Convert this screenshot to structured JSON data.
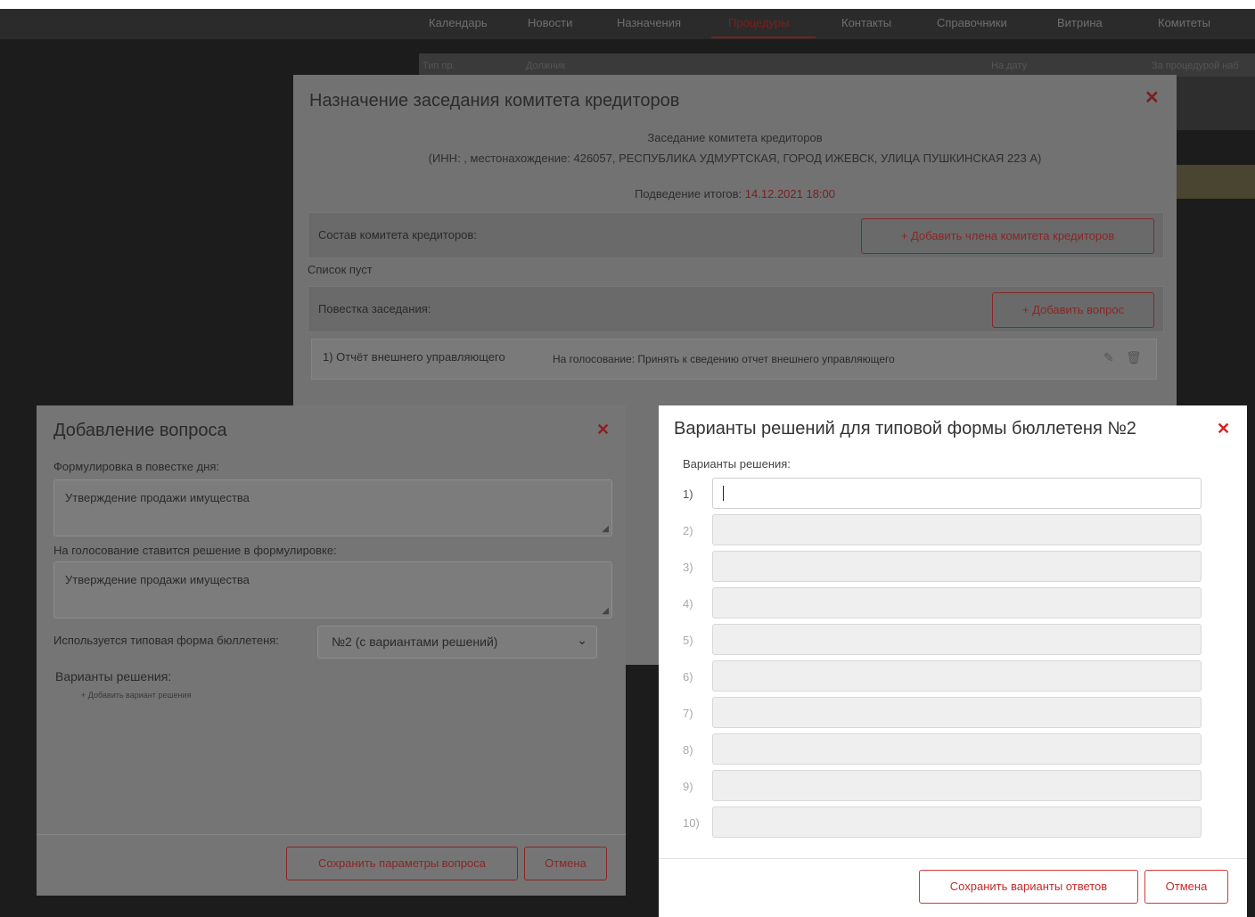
{
  "nav": {
    "items": [
      "Календарь",
      "Новости",
      "Назначения",
      "Процедуры",
      "Контакты",
      "Справочники",
      "Витрина",
      "Комитеты"
    ],
    "active": "Процедуры"
  },
  "background_table": {
    "headers": [
      "Тип пр.",
      "Должник",
      "На дату",
      "За процедурой наб"
    ]
  },
  "main_dialog": {
    "title": "Назначение заседания комитета кредиторов",
    "meeting_name": "Заседание комитета кредиторов",
    "address_line": "(ИНН: , местонахождение: 426057, РЕСПУБЛИКА УДМУРТСКАЯ, ГОРОД ИЖЕВСК, УЛИЦА ПУШКИНСКАЯ 223 А)",
    "results_label": "Подведение итогов:",
    "results_date": "14.12.2021 18:00",
    "committee_label": "Состав комитета кредиторов:",
    "add_member_button": "+ Добавить члена комитета кредиторов",
    "list_empty": "Список пуст",
    "agenda_label": "Повестка заседания:",
    "add_question_button": "+ Добавить вопрос",
    "agenda_item": {
      "question": "1) Отчёт внешнего управляющего",
      "vote": "На голосование: Принять к сведению отчет внешнего управляющего"
    }
  },
  "add_question_dialog": {
    "title": "Добавление вопроса",
    "agenda_wording_label": "Формулировка в повестке дня:",
    "agenda_wording_value": "Утверждение продажи имущества",
    "vote_wording_label": "На голосование ставится решение в формулировке:",
    "vote_wording_value": "Утверждение продажи имущества",
    "ballot_form_label": "Используется типовая форма бюллетеня:",
    "ballot_form_value": "№2 (с вариантами решений)",
    "options_label": "Варианты решения:",
    "add_option_link": "+ Добавить вариант решения",
    "save_button": "Сохранить параметры вопроса",
    "cancel_button": "Отмена"
  },
  "options_dialog": {
    "title": "Варианты решений для типовой формы бюллетеня №2",
    "options_label": "Варианты решения:",
    "rows": [
      {
        "num": "1)",
        "value": ""
      },
      {
        "num": "2)",
        "value": ""
      },
      {
        "num": "3)",
        "value": ""
      },
      {
        "num": "4)",
        "value": ""
      },
      {
        "num": "5)",
        "value": ""
      },
      {
        "num": "6)",
        "value": ""
      },
      {
        "num": "7)",
        "value": ""
      },
      {
        "num": "8)",
        "value": ""
      },
      {
        "num": "9)",
        "value": ""
      },
      {
        "num": "10)",
        "value": ""
      }
    ],
    "save_button": "Сохранить варианты ответов",
    "cancel_button": "Отмена"
  },
  "icons": {
    "close": "close-icon",
    "edit": "pencil-icon",
    "delete": "trash-icon",
    "dropdown": "chevron-down-icon",
    "resize": "resize-grip-icon"
  },
  "colors": {
    "accent": "#d43a3a",
    "accent_dim": "#8a2626",
    "overlay": "#727272"
  }
}
